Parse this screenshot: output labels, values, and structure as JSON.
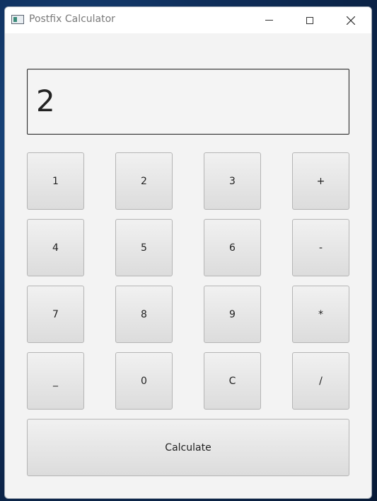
{
  "window": {
    "title": "Postfix Calculator",
    "controls": {
      "minimize": "minimize-icon",
      "maximize": "maximize-icon",
      "close": "✕"
    }
  },
  "display": {
    "value": "2"
  },
  "keypad": {
    "rows": [
      [
        "1",
        "2",
        "3",
        "+"
      ],
      [
        "4",
        "5",
        "6",
        "-"
      ],
      [
        "7",
        "8",
        "9",
        "*"
      ],
      [
        "_",
        "0",
        "C",
        "/"
      ]
    ]
  },
  "calculate": {
    "label": "Calculate"
  }
}
